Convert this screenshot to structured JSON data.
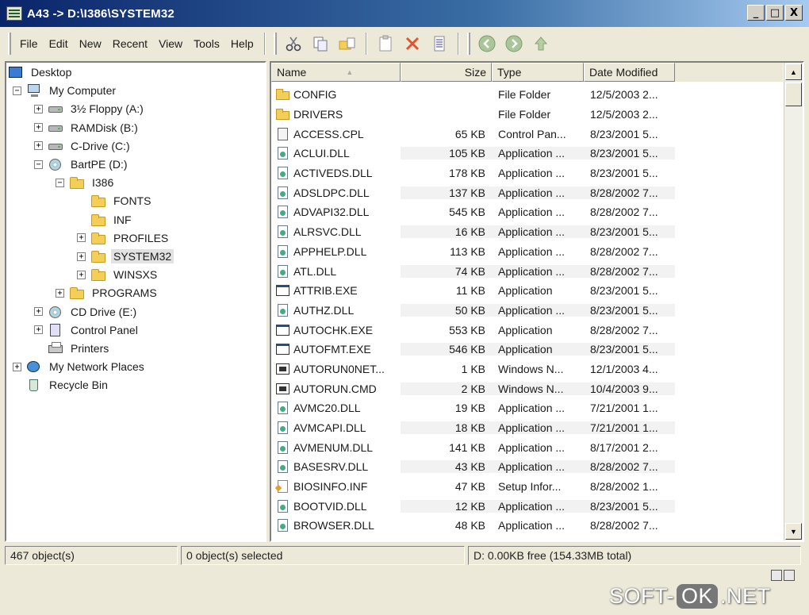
{
  "window": {
    "title": "A43 -> D:\\I386\\SYSTEM32",
    "minimize": "_",
    "restore": "□",
    "close": "X"
  },
  "menu": [
    "File",
    "Edit",
    "New",
    "Recent",
    "View",
    "Tools",
    "Help"
  ],
  "toolbar_icons": [
    "cut-icon",
    "copy-icon",
    "paste-into-icon",
    "paste-icon",
    "delete-icon",
    "properties-icon",
    "back-icon",
    "forward-icon",
    "up-icon"
  ],
  "tree": [
    {
      "label": "Desktop",
      "icon": "desktop-icon",
      "level": 0,
      "exp": "none"
    },
    {
      "label": "My Computer",
      "icon": "computer-icon",
      "level": 1,
      "exp": "minus"
    },
    {
      "label": "3½ Floppy (A:)",
      "icon": "floppy-icon",
      "level": 2,
      "exp": "plus"
    },
    {
      "label": "RAMDisk (B:)",
      "icon": "drive-icon",
      "level": 2,
      "exp": "plus"
    },
    {
      "label": "C-Drive (C:)",
      "icon": "drive-icon",
      "level": 2,
      "exp": "plus"
    },
    {
      "label": "BartPE (D:)",
      "icon": "cd-drive-icon",
      "level": 2,
      "exp": "minus"
    },
    {
      "label": "I386",
      "icon": "folder-icon",
      "level": 3,
      "exp": "minus"
    },
    {
      "label": "FONTS",
      "icon": "folder-icon",
      "level": 4,
      "exp": "none"
    },
    {
      "label": "INF",
      "icon": "folder-icon",
      "level": 4,
      "exp": "none"
    },
    {
      "label": "PROFILES",
      "icon": "folder-icon",
      "level": 4,
      "exp": "plus"
    },
    {
      "label": "SYSTEM32",
      "icon": "folder-icon",
      "level": 4,
      "exp": "plus",
      "selected": true
    },
    {
      "label": "WINSXS",
      "icon": "folder-icon",
      "level": 4,
      "exp": "plus"
    },
    {
      "label": "PROGRAMS",
      "icon": "folder-icon",
      "level": 3,
      "exp": "plus"
    },
    {
      "label": "CD Drive (E:)",
      "icon": "cd-drive-icon",
      "level": 2,
      "exp": "plus"
    },
    {
      "label": "Control Panel",
      "icon": "control-panel-icon",
      "level": 2,
      "exp": "plus"
    },
    {
      "label": "Printers",
      "icon": "printer-icon",
      "level": 2,
      "exp": "none"
    },
    {
      "label": "My Network Places",
      "icon": "network-icon",
      "level": 1,
      "exp": "plus"
    },
    {
      "label": "Recycle Bin",
      "icon": "recycle-bin-icon",
      "level": 1,
      "exp": "none"
    }
  ],
  "columns": {
    "name": "Name",
    "size": "Size",
    "type": "Type",
    "date": "Date Modified"
  },
  "files": [
    {
      "name": "CONFIG",
      "size": "",
      "type": "File Folder",
      "date": "12/5/2003 2...",
      "icon": "folder"
    },
    {
      "name": "DRIVERS",
      "size": "",
      "type": "File Folder",
      "date": "12/5/2003 2...",
      "icon": "folder"
    },
    {
      "name": "ACCESS.CPL",
      "size": "65 KB",
      "type": "Control Pan...",
      "date": "8/23/2001 5...",
      "icon": "cpl"
    },
    {
      "name": "ACLUI.DLL",
      "size": "105 KB",
      "type": "Application ...",
      "date": "8/23/2001 5...",
      "icon": "dll"
    },
    {
      "name": "ACTIVEDS.DLL",
      "size": "178 KB",
      "type": "Application ...",
      "date": "8/23/2001 5...",
      "icon": "dll"
    },
    {
      "name": "ADSLDPC.DLL",
      "size": "137 KB",
      "type": "Application ...",
      "date": "8/28/2002 7...",
      "icon": "dll"
    },
    {
      "name": "ADVAPI32.DLL",
      "size": "545 KB",
      "type": "Application ...",
      "date": "8/28/2002 7...",
      "icon": "dll"
    },
    {
      "name": "ALRSVC.DLL",
      "size": "16 KB",
      "type": "Application ...",
      "date": "8/23/2001 5...",
      "icon": "dll"
    },
    {
      "name": "APPHELP.DLL",
      "size": "113 KB",
      "type": "Application ...",
      "date": "8/28/2002 7...",
      "icon": "dll"
    },
    {
      "name": "ATL.DLL",
      "size": "74 KB",
      "type": "Application ...",
      "date": "8/28/2002 7...",
      "icon": "dll"
    },
    {
      "name": "ATTRIB.EXE",
      "size": "11 KB",
      "type": "Application",
      "date": "8/23/2001 5...",
      "icon": "exe"
    },
    {
      "name": "AUTHZ.DLL",
      "size": "50 KB",
      "type": "Application ...",
      "date": "8/23/2001 5...",
      "icon": "dll"
    },
    {
      "name": "AUTOCHK.EXE",
      "size": "553 KB",
      "type": "Application",
      "date": "8/28/2002 7...",
      "icon": "exe"
    },
    {
      "name": "AUTOFMT.EXE",
      "size": "546 KB",
      "type": "Application",
      "date": "8/23/2001 5...",
      "icon": "exe"
    },
    {
      "name": "AUTORUN0NET...",
      "size": "1 KB",
      "type": "Windows N...",
      "date": "12/1/2003 4...",
      "icon": "cmd"
    },
    {
      "name": "AUTORUN.CMD",
      "size": "2 KB",
      "type": "Windows N...",
      "date": "10/4/2003 9...",
      "icon": "cmd"
    },
    {
      "name": "AVMC20.DLL",
      "size": "19 KB",
      "type": "Application ...",
      "date": "7/21/2001 1...",
      "icon": "dll"
    },
    {
      "name": "AVMCAPI.DLL",
      "size": "18 KB",
      "type": "Application ...",
      "date": "7/21/2001 1...",
      "icon": "dll"
    },
    {
      "name": "AVMENUM.DLL",
      "size": "141 KB",
      "type": "Application ...",
      "date": "8/17/2001 2...",
      "icon": "dll"
    },
    {
      "name": "BASESRV.DLL",
      "size": "43 KB",
      "type": "Application ...",
      "date": "8/28/2002 7...",
      "icon": "dll"
    },
    {
      "name": "BIOSINFO.INF",
      "size": "47 KB",
      "type": "Setup Infor...",
      "date": "8/28/2002 1...",
      "icon": "inf"
    },
    {
      "name": "BOOTVID.DLL",
      "size": "12 KB",
      "type": "Application ...",
      "date": "8/23/2001 5...",
      "icon": "dll"
    },
    {
      "name": "BROWSER.DLL",
      "size": "48 KB",
      "type": "Application ...",
      "date": "8/28/2002 7...",
      "icon": "dll"
    }
  ],
  "status": {
    "objects": "467 object(s)",
    "selected": "0 object(s) selected",
    "free": "D: 0.00KB free (154.33MB total)"
  },
  "watermark": {
    "left": "SOFT-",
    "middle": "OK",
    "right": ".NET"
  }
}
